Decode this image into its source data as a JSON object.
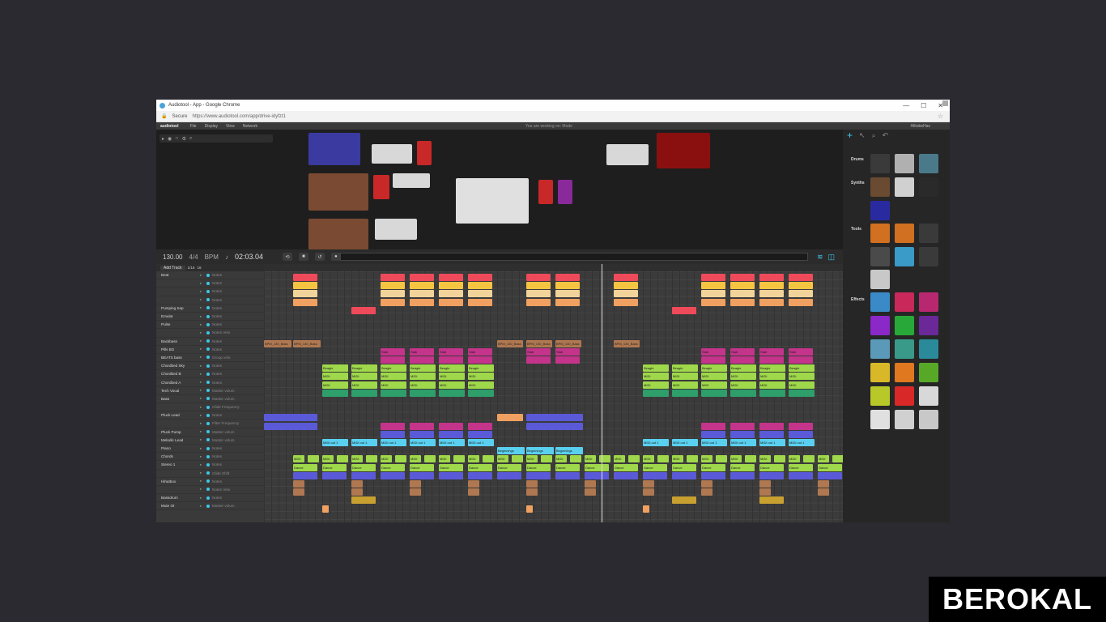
{
  "window": {
    "title": "Audiotool - App - Google Chrome",
    "controls": [
      "—",
      "☐",
      "✕"
    ]
  },
  "urlbar": {
    "secure": "Secure",
    "url": "https://www.audiotool.com/app/drive-idyfzt1"
  },
  "menubar": {
    "brand": "audiotool",
    "items": [
      "File",
      "Display",
      "View",
      "Network"
    ],
    "center": "You are working on: Mode",
    "user": "HiltobeHav"
  },
  "transport": {
    "bpm": "130.00",
    "signature": "4/4",
    "mode": "BPM",
    "time": "02:03.04"
  },
  "tracklist": {
    "add_track": "Add Track",
    "quantize": "1/16",
    "zoom": "16",
    "tracks": [
      {
        "name": "Beat",
        "sub": "Notes"
      },
      {
        "name": "",
        "sub": "Notes"
      },
      {
        "name": "",
        "sub": "Notes"
      },
      {
        "name": "",
        "sub": "Notes"
      },
      {
        "name": "Pumping Sep",
        "sub": "Notes"
      },
      {
        "name": "Emulat",
        "sub": "Notes"
      },
      {
        "name": "Pulse",
        "sub": "Notes"
      },
      {
        "name": "",
        "sub": "Notes Velo"
      },
      {
        "name": "Backbass",
        "sub": "Notes"
      },
      {
        "name": "Pills BG",
        "sub": "Notes"
      },
      {
        "name": "BEATS bass",
        "sub": "Group velo"
      },
      {
        "name": "Chordbed Sky",
        "sub": "Notes"
      },
      {
        "name": "Chordbed B",
        "sub": "Notes"
      },
      {
        "name": "Chordbed A",
        "sub": "Notes"
      },
      {
        "name": "Tech Vocal",
        "sub": "Master volum"
      },
      {
        "name": "Bass",
        "sub": "Master volum"
      },
      {
        "name": "",
        "sub": "Glide Frequency"
      },
      {
        "name": "Pluck Lead",
        "sub": "Notes"
      },
      {
        "name": "",
        "sub": "Filter Frequency"
      },
      {
        "name": "Pluck Pump",
        "sub": "Master volum"
      },
      {
        "name": "Melodic Lead",
        "sub": "Master volum"
      },
      {
        "name": "Piano",
        "sub": "Notes"
      },
      {
        "name": "Chords",
        "sub": "Notes"
      },
      {
        "name": "Stereo 1",
        "sub": "Notes"
      },
      {
        "name": "",
        "sub": "Glide Shift"
      },
      {
        "name": "Hihatbox",
        "sub": "Notes"
      },
      {
        "name": "",
        "sub": "Notes Velo"
      },
      {
        "name": "Bassdrum",
        "sub": "Notes"
      },
      {
        "name": "Mute Ot",
        "sub": "Master volum"
      }
    ]
  },
  "clip_labels": {
    "bass": "BPM_130_Bass",
    "chord": "Beagle",
    "midi": "MIDI",
    "lead": "MIDI out 1",
    "arp": "Beginnings",
    "stab": "Stab",
    "dance": "Dance"
  },
  "panel": {
    "categories": [
      "Drums",
      "Synths",
      "Tools",
      "Effects"
    ]
  },
  "overlay_logo": "BEROKAL",
  "colors": {
    "accent": "#3ec8f0",
    "red": "#ef4a5a",
    "yellow": "#f5c542",
    "orange": "#f0a060",
    "magenta": "#c4348a",
    "green": "#9fd84a",
    "blue": "#5a5ad8",
    "cyan": "#5ad0f0",
    "brown": "#b07850"
  }
}
